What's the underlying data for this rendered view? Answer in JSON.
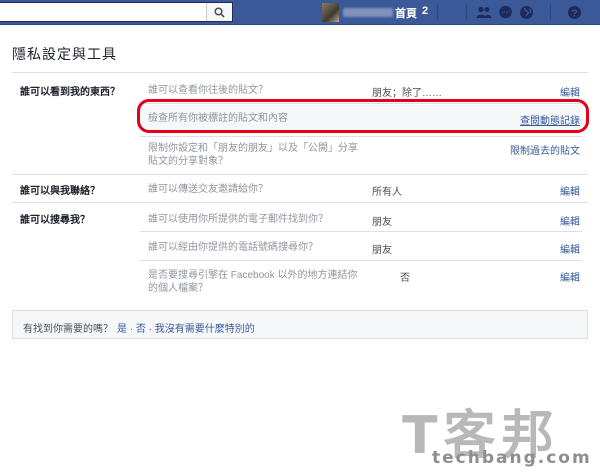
{
  "topbar": {
    "home_label": "首頁",
    "home_count": "2",
    "icons": [
      "search-icon",
      "friend-requests-icon",
      "messages-icon",
      "globe-notifications-icon",
      "help-icon"
    ]
  },
  "page": {
    "title": "隱私設定與工具"
  },
  "sections": [
    {
      "label": "誰可以看到我的東西？",
      "rows": [
        {
          "question": "誰可以查看你往後的貼文？",
          "value": "朋友；除了……",
          "action": "編輯"
        },
        {
          "question": "檢查所有你被標註的貼文和內容",
          "value": "",
          "action": "查閱動態記錄"
        },
        {
          "question_line1": "限制你設定和「朋友的朋友」以及「公開」分享",
          "question_line2": "貼文的分享對象？",
          "value": "",
          "action": "限制過去的貼文"
        }
      ]
    },
    {
      "label": "誰可以與我聯絡？",
      "rows": [
        {
          "question": "誰可以傳送交友邀請給你？",
          "value": "所有人",
          "action": "編輯"
        }
      ]
    },
    {
      "label": "誰可以搜尋我？",
      "rows": [
        {
          "question": "誰可以使用你所提供的電子郵件找到你？",
          "value": "朋友",
          "action": "編輯"
        },
        {
          "question": "誰可以經由你提供的電話號碼搜尋你？",
          "value": "朋友",
          "action": "編輯"
        },
        {
          "question_line1": "是否要搜尋引擎在 Facebook 以外的地方連結你",
          "question_line2": "的個人檔案？",
          "value": "否",
          "action": "編輯"
        }
      ]
    }
  ],
  "footer": {
    "question": "有找到你需要的嗎？",
    "links": "是 · 否 · 我沒有需要什麼特別的"
  },
  "watermark": {
    "logo_text": "T客邦",
    "site": "techbang.com"
  },
  "colors": {
    "header_blue": "#3b5998",
    "link_blue": "#365899",
    "highlight_red": "#e3001b"
  }
}
